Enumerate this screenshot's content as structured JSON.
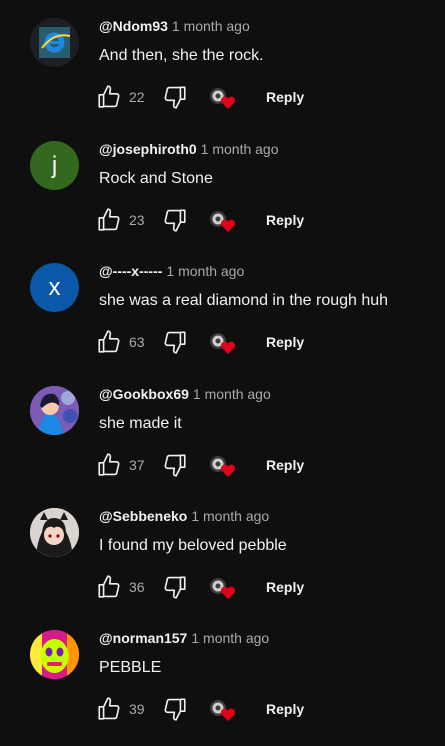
{
  "comments": [
    {
      "handle": "@Ndom93",
      "time": "1 month ago",
      "text": "And then, she the rock.",
      "likes": "22",
      "reply_label": "Reply",
      "avatar": {
        "type": "image",
        "icon": "browser-logo-avatar",
        "bg": "#2a5d6b"
      }
    },
    {
      "handle": "@josephiroth0",
      "time": "1 month ago",
      "text": "Rock and Stone",
      "likes": "23",
      "reply_label": "Reply",
      "avatar": {
        "type": "letter",
        "letter": "j",
        "bg": "#33691e"
      }
    },
    {
      "handle": "@----x-----",
      "time": "1 month ago",
      "text": "she was a real diamond in the rough huh",
      "likes": "63",
      "reply_label": "Reply",
      "avatar": {
        "type": "letter",
        "letter": "x",
        "bg": "#0b57a8"
      }
    },
    {
      "handle": "@Gookbox69",
      "time": "1 month ago",
      "text": "she made it",
      "likes": "37",
      "reply_label": "Reply",
      "avatar": {
        "type": "image",
        "icon": "anime-character-avatar",
        "bg": "#7b5bb5"
      }
    },
    {
      "handle": "@Sebbeneko",
      "time": "1 month ago",
      "text": "I found my beloved pebble",
      "likes": "36",
      "reply_label": "Reply",
      "avatar": {
        "type": "image",
        "icon": "anime-character-avatar",
        "bg": "#d9d4cf"
      }
    },
    {
      "handle": "@norman157",
      "time": "1 month ago",
      "text": "PEBBLE",
      "likes": "39",
      "reply_label": "Reply",
      "avatar": {
        "type": "image",
        "icon": "colorful-face-avatar",
        "bg": "#d81b8c"
      }
    }
  ],
  "colors": {
    "background": "#0f0f0f",
    "text": "#f1f1f1",
    "muted": "#aaaaaa",
    "heart": "#e1001a"
  }
}
